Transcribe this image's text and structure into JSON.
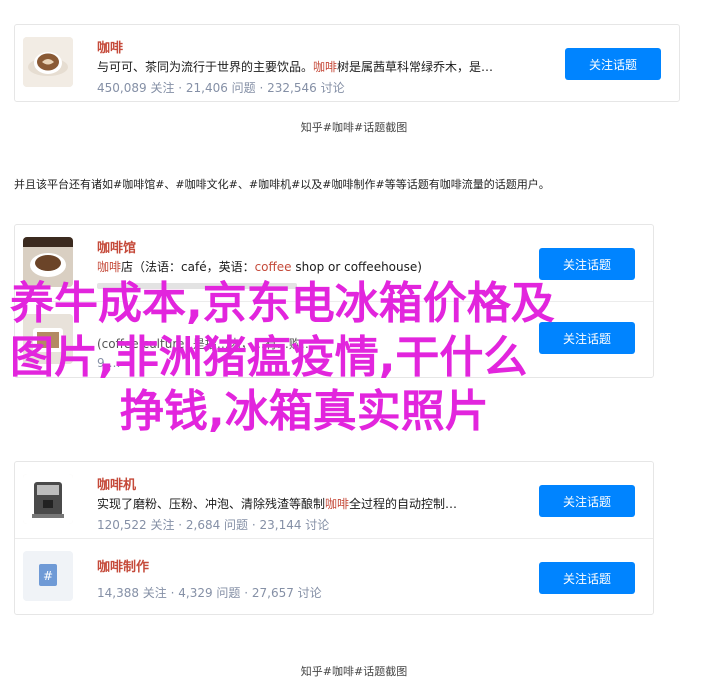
{
  "card1": {
    "items": [
      {
        "name": "咖啡",
        "desc_pre": "与可可、茶同为流行于世界的主要饮品。",
        "desc_kw": "咖啡",
        "desc_post": "树是属茜草科常绿乔木，是…",
        "meta": "450,089 关注 · 21,406 问题 · 232,546 讨论",
        "button": "关注话题"
      }
    ]
  },
  "caption1": "知乎#咖啡#话题截图",
  "paragraph": "并且该平台还有诸如#咖啡馆#、#咖啡文化#、#咖啡机#以及#咖啡制作#等等话题有咖啡流量的话题用户。",
  "card2": {
    "items": [
      {
        "name": "咖啡馆",
        "desc_kw": "咖啡",
        "desc_post": "店（法语：café，英语：",
        "desc_kw2": "coffee",
        "desc_post2": " shop or coffeehouse)",
        "meta": "",
        "button": "关注话题"
      },
      {
        "name": "",
        "desc_kw": "",
        "desc_post": "",
        "meta": "",
        "desc_fragment": "(coffee culture) 是指…内，…有…购…",
        "meta_fragment": "9,…",
        "button": "关注话题"
      }
    ]
  },
  "card3": {
    "items": [
      {
        "name": "咖啡机",
        "desc_pre": "实现了磨粉、压粉、冲泡、清除残渣等酿制",
        "desc_kw": "咖啡",
        "desc_post": "全过程的自动控制…",
        "meta": "120,522 关注 · 2,684 问题 · 23,144 讨论",
        "button": "关注话题"
      },
      {
        "name": "咖啡制作",
        "desc_pre": "",
        "desc_kw": "",
        "desc_post": "",
        "meta": "14,388 关注 · 4,329 问题 · 27,657 讨论",
        "button": "关注话题"
      }
    ]
  },
  "caption2": "知乎#咖啡#话题截图",
  "overlay": {
    "line1": "养牛成本,京东电冰箱价格及",
    "line2": "图片,非洲猪瘟疫情,干什么",
    "line3": "挣钱,冰箱真实照片"
  },
  "colors": {
    "accent": "#0084ff",
    "keyword": "#c54a3a",
    "overlay": "#e225dd",
    "meta": "#8590a6"
  }
}
